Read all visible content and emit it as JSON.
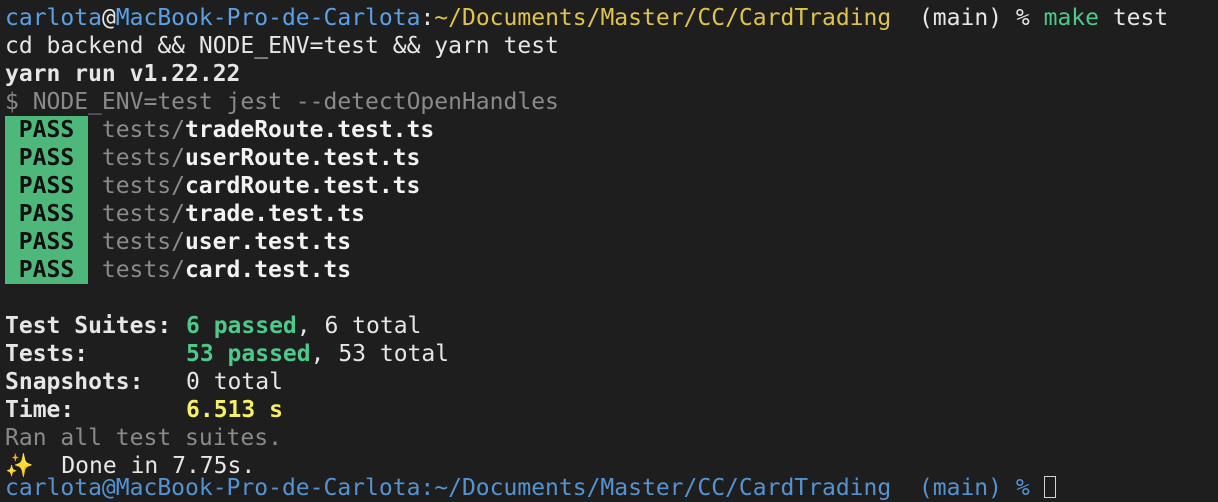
{
  "prompt": {
    "user": "carlota",
    "at": "@",
    "host": "MacBook-Pro-de-Carlota",
    "colon": ":",
    "path": "~/Documents/Master/CC/CardTrading",
    "branch": "  (main) % ",
    "command": "make",
    "args": " test"
  },
  "output": {
    "cmd_echo": "cd backend && NODE_ENV=test && yarn test",
    "yarn_version": "yarn run v1.22.22",
    "jest_cmd": "$ NODE_ENV=test jest --detectOpenHandles"
  },
  "results": [
    {
      "status": "PASS",
      "dir": "tests/",
      "file": "tradeRoute.test.ts"
    },
    {
      "status": "PASS",
      "dir": "tests/",
      "file": "userRoute.test.ts"
    },
    {
      "status": "PASS",
      "dir": "tests/",
      "file": "cardRoute.test.ts"
    },
    {
      "status": "PASS",
      "dir": "tests/",
      "file": "trade.test.ts"
    },
    {
      "status": "PASS",
      "dir": "tests/",
      "file": "user.test.ts"
    },
    {
      "status": "PASS",
      "dir": "tests/",
      "file": "card.test.ts"
    }
  ],
  "summary": {
    "suites_label": "Test Suites:",
    "suites_passed": "6 passed",
    "suites_total": ", 6 total",
    "tests_label": "Tests:",
    "tests_passed": "53 passed",
    "tests_total": ", 53 total",
    "snapshots_label": "Snapshots:",
    "snapshots_value": "0 total",
    "time_label": "Time:",
    "time_value": "6.513 s",
    "ran_all": "Ran all test suites.",
    "sparkle": "✨",
    "done": "  Done in 7.75s."
  },
  "next_prompt": {
    "text": "carlota@MacBook-Pro-de-Carlota:~/Documents/Master/CC/CardTrading  (main) % "
  },
  "colors": {
    "background": "#1e1e1e",
    "prompt_blue": "#5aa0e6",
    "path_yellow": "#e0c34a",
    "pass_green": "#4db87a",
    "time_yellow": "#f5ef6a"
  }
}
